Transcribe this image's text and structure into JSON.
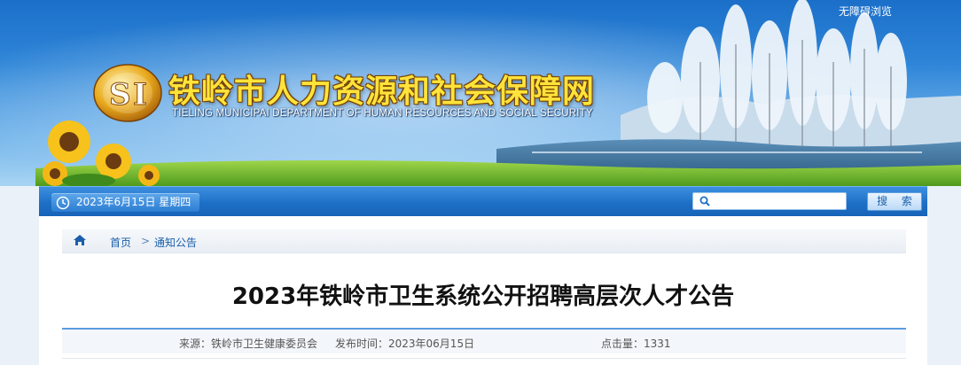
{
  "header": {
    "accessibility_link": "无障碍浏览",
    "site_title": "铁岭市人力资源和社会保障网",
    "site_subtitle": "TIELING MUNICIPAI DEPARTMENT OF HUMAN RESOURCES AND SOCIAL SECURITY",
    "logo_icon": "si-emblem-icon"
  },
  "navbar": {
    "date_text": "2023年6月15日 星期四",
    "date_icon": "clock-icon",
    "search_placeholder": "",
    "search_value": "",
    "search_button_label": "搜 索",
    "search_icon": "search-icon"
  },
  "breadcrumb": {
    "home_icon": "home-icon",
    "home_label": "首页",
    "separator": ">",
    "current_label": "通知公告"
  },
  "article": {
    "title": "2023年铁岭市卫生系统公开招聘高层次人才公告",
    "source": "来源：铁岭市卫生健康委员会",
    "publish_time": "发布时间：2023年06月15日",
    "hits": "点击量：1331"
  },
  "colors": {
    "nav_blue": "#1d6fc6",
    "title_yellow": "#ffe33a",
    "link_blue": "#1a5fab",
    "divider_blue": "#5b9be0"
  }
}
